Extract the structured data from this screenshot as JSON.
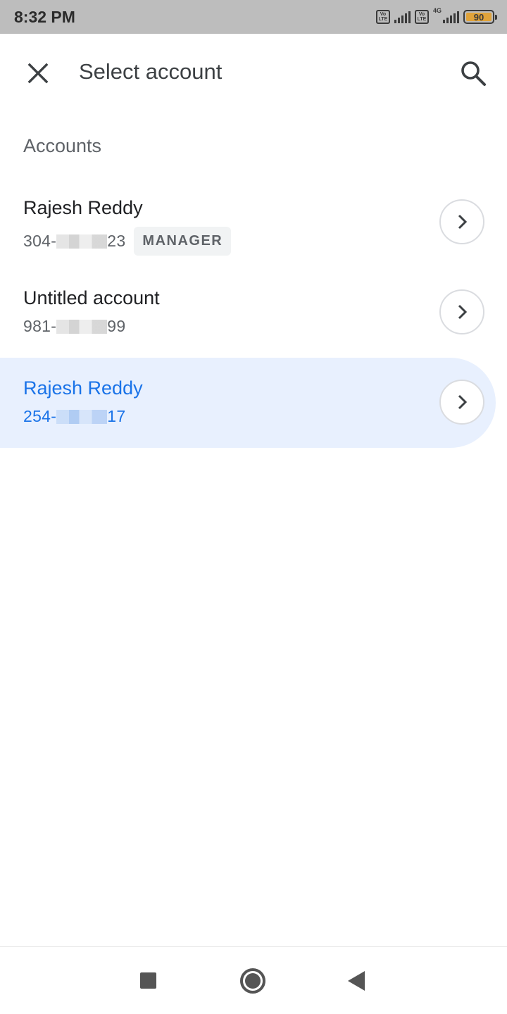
{
  "status_bar": {
    "time": "8:32 PM",
    "volte_label": "Vo LTE",
    "network_label": "4G",
    "battery_level": "90"
  },
  "app_bar": {
    "title": "Select account"
  },
  "accounts_section": {
    "label": "Accounts"
  },
  "accounts": [
    {
      "name": "Rajesh Reddy",
      "number_prefix": "304-",
      "number_suffix": "23",
      "badge": "MANAGER",
      "selected": false
    },
    {
      "name": "Untitled account",
      "number_prefix": "981-",
      "number_suffix": "99",
      "badge": "",
      "selected": false
    },
    {
      "name": "Rajesh Reddy",
      "number_prefix": "254-",
      "number_suffix": "17",
      "badge": "",
      "selected": true
    }
  ],
  "colors": {
    "accent": "#1a73e8",
    "selected_bg": "#e8f0fe",
    "status_bar_bg": "#bdbdbd",
    "battery_fill": "#e0a33a"
  },
  "icons": {
    "close": "close-icon",
    "search": "search-icon",
    "chevron": "chevron-right-icon",
    "nav_recents": "recents-icon",
    "nav_home": "home-icon",
    "nav_back": "back-icon"
  }
}
